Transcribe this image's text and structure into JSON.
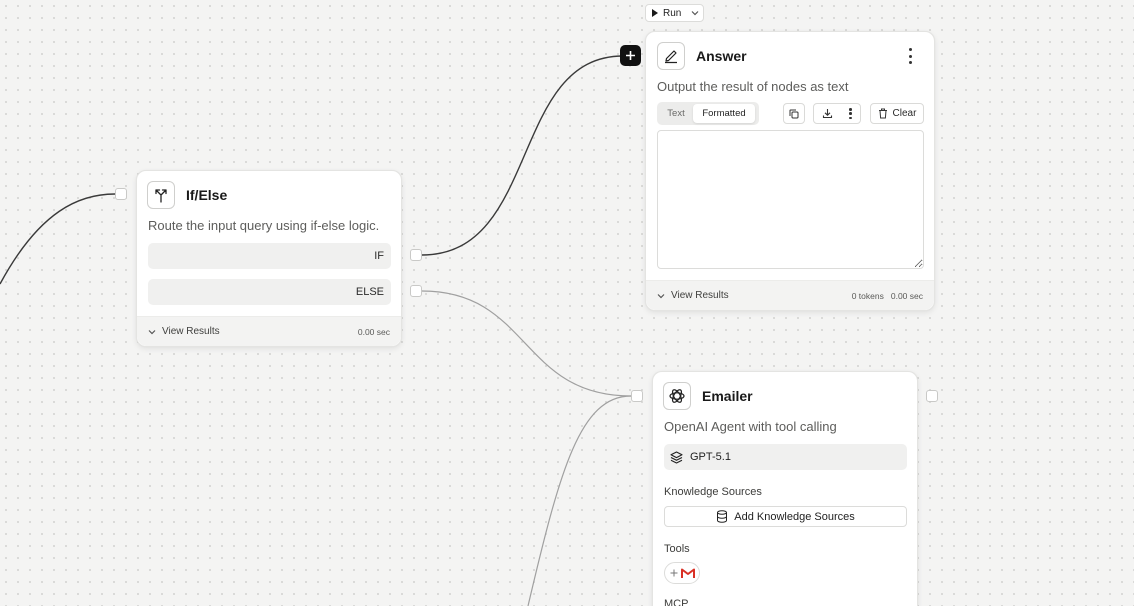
{
  "toolbar": {
    "run_label": "Run"
  },
  "ifelse": {
    "title": "If/Else",
    "description": "Route the input query using if-else logic.",
    "conditions": [
      {
        "label": "IF"
      },
      {
        "label": "ELSE"
      }
    ],
    "footer": {
      "view_results": "View Results",
      "time": "0.00 sec"
    }
  },
  "answer": {
    "title": "Answer",
    "description": "Output the result of nodes as text",
    "tabs": [
      {
        "label": "Text",
        "active": false
      },
      {
        "label": "Formatted",
        "active": true
      }
    ],
    "clear_label": "Clear",
    "output_value": "",
    "footer": {
      "view_results": "View Results",
      "tokens": "0 tokens",
      "time": "0.00 sec"
    }
  },
  "emailer": {
    "title": "Emailer",
    "description": "OpenAI Agent with tool calling",
    "model": "GPT-5.1",
    "knowledge_label": "Knowledge Sources",
    "add_knowledge_label": "Add Knowledge Sources",
    "tools_label": "Tools",
    "tools": [
      {
        "icon": "gmail-icon"
      }
    ],
    "mcp_label": "MCP"
  },
  "colors": {
    "canvas": "#f4f4f3",
    "edge_active": "#3a3a3a",
    "edge_inactive": "#a0a0a0",
    "gmail_red": "#d93025"
  }
}
